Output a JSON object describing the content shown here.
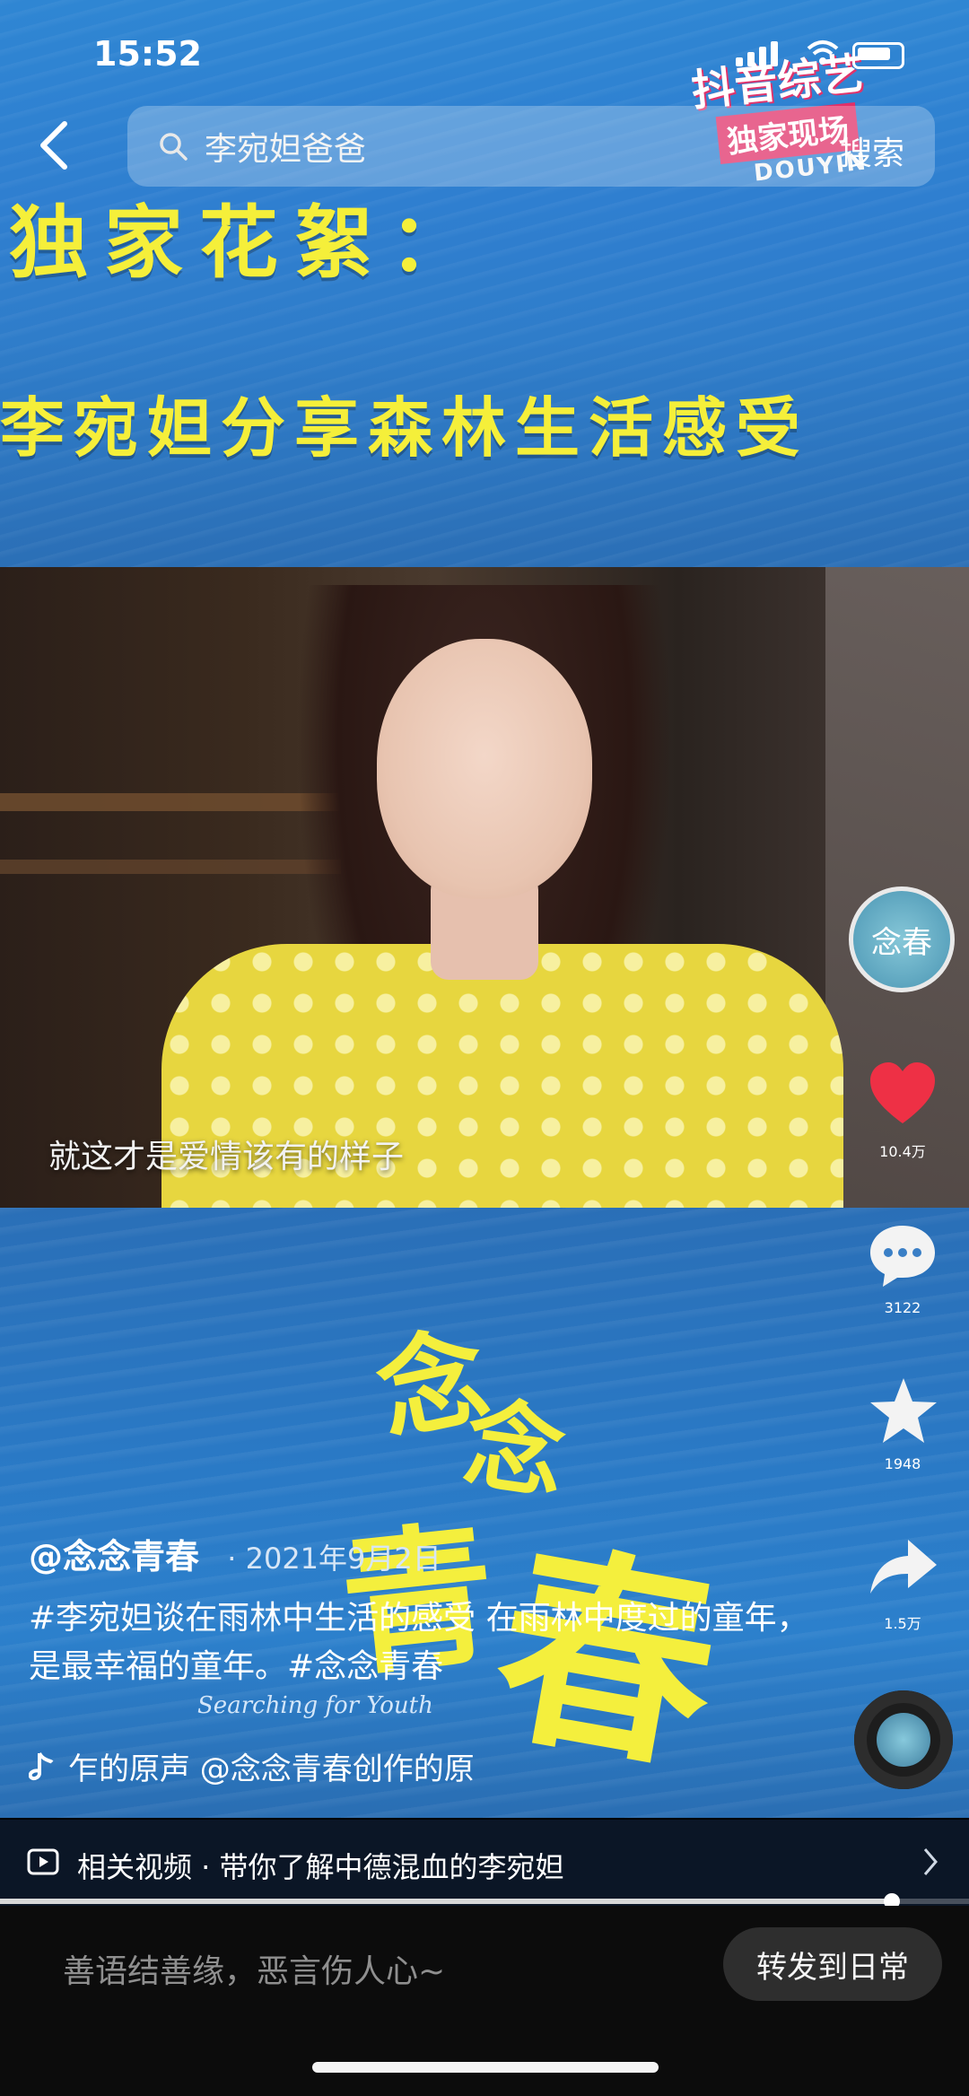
{
  "status_bar": {
    "time": "15:52"
  },
  "search": {
    "query": "李宛妲爸爸",
    "action_label": "搜索"
  },
  "video": {
    "headline_line1": "独家花絮：",
    "headline_line2": "李宛妲分享森林生活感受",
    "subtitle": "就这才是爱情该有的样子",
    "brand_watermark": {
      "line1": "抖音综艺",
      "line2": "独家现场",
      "line3": "DOUYIN"
    },
    "title_art_text": {
      "c1": "念",
      "c2": "念",
      "c3": "青",
      "c4": "春",
      "subtitle": "Searching for Youth"
    }
  },
  "rail": {
    "avatar_text": "念春",
    "likes": "10.4万",
    "comments": "3122",
    "favorites": "1948",
    "shares": "1.5万"
  },
  "post": {
    "author": "@念念青春",
    "date": "· 2021年9月2日",
    "description": "#李宛妲谈在雨林中生活的感受 在雨林中度过的童年，是最幸福的童年。#念念青春",
    "music": "乍的原声   @念念青春创作的原"
  },
  "related": {
    "text": "相关视频 · 带你了解中德混血的李宛妲"
  },
  "progress": {
    "fraction": 0.92
  },
  "bottom": {
    "comment_placeholder": "善语结善缘，恶言伤人心~",
    "repost_label": "转发到日常"
  },
  "colors": {
    "headline": "#f5ef3a",
    "like_red": "#ee3045",
    "brand_pink": "#e13069"
  }
}
